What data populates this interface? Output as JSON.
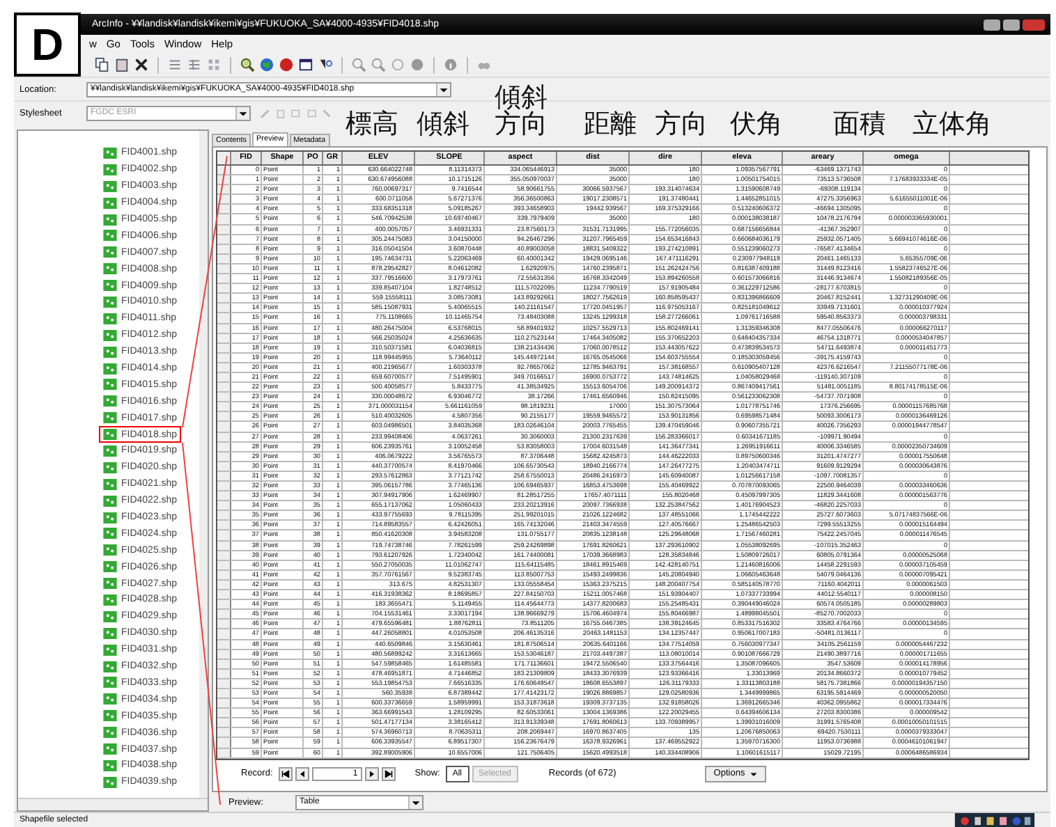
{
  "figure_label": "D",
  "window": {
    "title": "ArcInfo - ¥¥landisk¥landisk¥ikemi¥gis¥FUKUOKA_SA¥4000-4935¥FID4018.shp"
  },
  "menu": [
    "w",
    "Go",
    "Tools",
    "Window",
    "Help"
  ],
  "location": {
    "label": "Location:",
    "value": "¥¥landisk¥landisk¥ikemi¥gis¥FUKUOKA_SA¥4000-4935¥FID4018.shp"
  },
  "stylesheet": {
    "label": "Stylesheet",
    "value": "FGDC ESRI"
  },
  "tree": {
    "items": [
      {
        "label": "FID4001.shp",
        "highlighted": false
      },
      {
        "label": "FID4002.shp",
        "highlighted": false
      },
      {
        "label": "FID4003.shp",
        "highlighted": false
      },
      {
        "label": "FID4004.shp",
        "highlighted": false
      },
      {
        "label": "FID4005.shp",
        "highlighted": false
      },
      {
        "label": "FID4006.shp",
        "highlighted": false
      },
      {
        "label": "FID4007.shp",
        "highlighted": false
      },
      {
        "label": "FID4008.shp",
        "highlighted": false
      },
      {
        "label": "FID4009.shp",
        "highlighted": false
      },
      {
        "label": "FID4010.shp",
        "highlighted": false
      },
      {
        "label": "FID4011.shp",
        "highlighted": false
      },
      {
        "label": "FID4012.shp",
        "highlighted": false
      },
      {
        "label": "FID4013.shp",
        "highlighted": false
      },
      {
        "label": "FID4014.shp",
        "highlighted": false
      },
      {
        "label": "FID4015.shp",
        "highlighted": false
      },
      {
        "label": "FID4016.shp",
        "highlighted": false
      },
      {
        "label": "FID4017.shp",
        "highlighted": false
      },
      {
        "label": "FID4018.shp",
        "highlighted": true
      },
      {
        "label": "FID4019.shp",
        "highlighted": false
      },
      {
        "label": "FID4020.shp",
        "highlighted": false
      },
      {
        "label": "FID4021.shp",
        "highlighted": false
      },
      {
        "label": "FID4022.shp",
        "highlighted": false
      },
      {
        "label": "FID4023.shp",
        "highlighted": false
      },
      {
        "label": "FID4024.shp",
        "highlighted": false
      },
      {
        "label": "FID4025.shp",
        "highlighted": false
      },
      {
        "label": "FID4026.shp",
        "highlighted": false
      },
      {
        "label": "FID4027.shp",
        "highlighted": false
      },
      {
        "label": "FID4028.shp",
        "highlighted": false
      },
      {
        "label": "FID4029.shp",
        "highlighted": false
      },
      {
        "label": "FID4030.shp",
        "highlighted": false
      },
      {
        "label": "FID4031.shp",
        "highlighted": false
      },
      {
        "label": "FID4032.shp",
        "highlighted": false
      },
      {
        "label": "FID4033.shp",
        "highlighted": false
      },
      {
        "label": "FID4034.shp",
        "highlighted": false
      },
      {
        "label": "FID4035.shp",
        "highlighted": false
      },
      {
        "label": "FID4036.shp",
        "highlighted": false
      },
      {
        "label": "FID4037.shp",
        "highlighted": false
      },
      {
        "label": "FID4038.shp",
        "highlighted": false
      },
      {
        "label": "FID4039.shp",
        "highlighted": false
      }
    ]
  },
  "tabs": [
    {
      "label": "Contents",
      "selected": false
    },
    {
      "label": "Preview",
      "selected": true
    },
    {
      "label": "Metadata",
      "selected": false
    }
  ],
  "annotations": [
    "標高",
    "傾斜",
    "傾斜方向",
    "距離",
    "方向",
    "伏角",
    "面積",
    "立体角"
  ],
  "table": {
    "columns": [
      "FID",
      "Shape",
      "PO",
      "GR",
      "ELEV",
      "SLOPE",
      "aspect",
      "dist",
      "dire",
      "eleva",
      "areary",
      "omega"
    ],
    "rows": [
      [
        "0",
        "Point",
        "1",
        "1",
        "630.664022748",
        "8.11314373",
        "334.065446913",
        "35000",
        "180",
        "1.09357567791",
        "-63469.1371743",
        "0"
      ],
      [
        "1",
        "Point",
        "2",
        "1",
        "630.674956088",
        "10.1715126",
        "355.050970037",
        "35000",
        "180",
        "1.00501754015",
        "73513.5736508",
        "7.17683933334E-05"
      ],
      [
        "2",
        "Point",
        "3",
        "1",
        "760.00697317",
        "9.7416544",
        "58.90661755",
        "30066.5937567",
        "193.314074634",
        "1.31590608749",
        "-69308.119134",
        "0"
      ],
      [
        "3",
        "Point",
        "4",
        "1",
        "600.0711058",
        "5.67271376",
        "356.36500863",
        "19017.2308571",
        "191.37480441",
        "1.44652851015",
        "47275.3356963",
        "5.61655011001E-06"
      ],
      [
        "4",
        "Point",
        "5",
        "1",
        "333.68351318",
        "5.09185267",
        "393.34658903",
        "19442.939567",
        "169.375329166",
        "0.513240606372",
        "-46694.1305095",
        "0"
      ],
      [
        "5",
        "Point",
        "6",
        "1",
        "546.70942538",
        "10.69740467",
        "339.7979409",
        "35000",
        "180",
        "0.000138038187",
        "10478.2176794",
        "0.000003365930001"
      ],
      [
        "6",
        "Point",
        "7",
        "1",
        "400.0057057",
        "3.46931331",
        "23.87560173",
        "31531.7131995",
        "155.772056035",
        "0.687156656844",
        "-41367.352907",
        "0"
      ],
      [
        "7",
        "Point",
        "8",
        "1",
        "305.24475083",
        "3.04150000",
        "94.26467296",
        "31207.7965459",
        "154.653416843",
        "0.660684036179",
        "25932.0571405",
        "5.66941074616E-06"
      ],
      [
        "8",
        "Point",
        "9",
        "1",
        "316.05041504",
        "3.60870448",
        "40.89003058",
        "18831.5409322",
        "193.274210891",
        "0.551239060273",
        "-76587.4134654",
        "0"
      ],
      [
        "9",
        "Point",
        "10",
        "1",
        "195.74634731",
        "5.22063469",
        "60.40001342",
        "19429.0695146",
        "167.471116291",
        "0.230977948119",
        "20461.1465133",
        "5.65355709E-06"
      ],
      [
        "10",
        "Point",
        "11",
        "1",
        "878.29542827",
        "8.04612082",
        "1.62920975",
        "14760.2395871",
        "151.262424756",
        "0.816387409188",
        "31449.8123416",
        "1.55823746527E-06"
      ],
      [
        "11",
        "Point",
        "12",
        "1",
        "337.79516600",
        "3.17973761",
        "72.55631356",
        "16768.3342049",
        "153.894260558",
        "0.601573066816",
        "31446.9134674",
        "1.55082189356E-05"
      ],
      [
        "12",
        "Point",
        "13",
        "1",
        "339.85407104",
        "1.82748512",
        "111.57022095",
        "11234.7790519",
        "157.91905484",
        "0.361229712586",
        "-28177.6703815",
        "0"
      ],
      [
        "13",
        "Point",
        "14",
        "1",
        "559.15558111",
        "3.08573081",
        "143.89292661",
        "18027.7562619",
        "160.858595437",
        "0.831396866609",
        "20467.8152441",
        "1.32731290409E-06"
      ],
      [
        "14",
        "Point",
        "15",
        "1",
        "585.15087931",
        "5.40065515",
        "140.21161547",
        "17720.0451957",
        "116.975053167",
        "0.825181049612",
        "33949.7131601",
        "0.000010377924"
      ],
      [
        "15",
        "Point",
        "16",
        "1",
        "775.1108665",
        "10.11465754",
        "73.48403088",
        "13245.1299318",
        "158.277266061",
        "1.09761716588",
        "59540.8563373",
        "0.000003798331"
      ],
      [
        "16",
        "Point",
        "17",
        "1",
        "480.26475004",
        "6.53768015",
        "58.89401932",
        "10257.5529713",
        "155.802469141",
        "1.31359346308",
        "8477.05506476",
        "0.000066270117"
      ],
      [
        "17",
        "Point",
        "18",
        "1",
        "566.25035024",
        "4.25636635",
        "110.27523144",
        "17464.3405082",
        "155.370652203",
        "0.648404357334",
        "46754.1318771",
        "0.0000534047857"
      ],
      [
        "18",
        "Point",
        "19",
        "1",
        "310.50371581",
        "6.04036815",
        "138.21434436",
        "17060.0078512",
        "153.443057622",
        "0.473839534573",
        "54711.6493874",
        "0.000011451773"
      ],
      [
        "19",
        "Point",
        "20",
        "1",
        "118.99445955",
        "5.73640112",
        "145.44972144",
        "16765.0545066",
        "154.603755554",
        "0.185303059456",
        "-39175.4159743",
        "0"
      ],
      [
        "20",
        "Point",
        "21",
        "1",
        "400.21965677",
        "1.60303378",
        "92.78657062",
        "12785.9463791",
        "157.38168557",
        "0.610905407128",
        "42376.6216547",
        "7.21155077178E-06"
      ],
      [
        "21",
        "Point",
        "22",
        "1",
        "659.60700577",
        "7.51495901",
        "349.70166517",
        "16900.0753772",
        "143.74814625",
        "1.04058029468",
        "-119140.307109",
        "0"
      ],
      [
        "22",
        "Point",
        "23",
        "1",
        "500.40058577",
        "5.8433775",
        "41.38534925",
        "15513.6054706",
        "149.200914372",
        "0.867409417561",
        "51481.0051185",
        "8.80174178515E-06"
      ],
      [
        "23",
        "Point",
        "24",
        "1",
        "330.00048672",
        "6.93046772",
        "38.17266",
        "17461.6560946",
        "150.82415095",
        "0.561233062308",
        "-54737.7071908",
        "0"
      ],
      [
        "24",
        "Point",
        "25",
        "1",
        "371.000031154",
        "5.661161059",
        "98.1819231",
        "17000",
        "151.307573064",
        "1.01778751746",
        "17376.256695",
        "0.00001157685768"
      ],
      [
        "25",
        "Point",
        "26",
        "1",
        "510.40032605",
        "4.5807356",
        "90.2155177",
        "19559.9465572",
        "153.90131856",
        "0.69598571484",
        "50093.3006173",
        "0.0000136469126"
      ],
      [
        "26",
        "Point",
        "27",
        "1",
        "603.04986501",
        "3.84035368",
        "183.02646104",
        "20003.7765455",
        "139.470459046",
        "0.90607355721",
        "40026.7356293",
        "0.00001944778547"
      ],
      [
        "27",
        "Point",
        "28",
        "1",
        "233.99408406",
        "4.0637261",
        "30.3060003",
        "21300.2317639",
        "156.283366017",
        "0.60341671185",
        "-109971.90494",
        "0"
      ],
      [
        "28",
        "Point",
        "29",
        "1",
        "606.23935761",
        "3.10052458",
        "53.83058003",
        "17004.6031548",
        "141.36477341",
        "1.26951916611",
        "40006.3346585",
        "0.00002350734609"
      ],
      [
        "29",
        "Point",
        "30",
        "1",
        "406.0679222",
        "3.56765573",
        "87.3706448",
        "15682.4245873",
        "144.46222033",
        "0.89750600346",
        "31201.4747277",
        "0.000017550648"
      ],
      [
        "30",
        "Point",
        "31",
        "1",
        "440.37700574",
        "8.41970466",
        "106.65730543",
        "18940.2166774",
        "147.26477275",
        "1.20403474711",
        "91609.9129294",
        "0.000030643876"
      ],
      [
        "31",
        "Point",
        "32",
        "1",
        "293.57612863",
        "3.77121742",
        "258.67550013",
        "20486.2416973",
        "145.60940087",
        "1.01256617158",
        "-1097.70081357",
        "0"
      ],
      [
        "32",
        "Point",
        "33",
        "1",
        "395.06157786",
        "3.77465136",
        "106.69465937",
        "16853.4753698",
        "155.40469922",
        "0.707870093065",
        "22500.9464039",
        "0.000033460636"
      ],
      [
        "33",
        "Point",
        "34",
        "1",
        "307.94917906",
        "1.62469907",
        "81.28517255",
        "17657.4071111",
        "155.8020468",
        "0.45097997305",
        "11829.3441608",
        "0.000001563776"
      ],
      [
        "34",
        "Point",
        "35",
        "1",
        "655.17137062",
        "1.05060433",
        "233.20213916",
        "20097.7366938",
        "132.253847562",
        "1.40176904523",
        "-46820.2257033",
        "0"
      ],
      [
        "35",
        "Point",
        "36",
        "1",
        "433.97755693",
        "9.78115395",
        "251.99201015",
        "21026.1224682",
        "137.48551066",
        "1.1745442222",
        "25727.6073603",
        "5.07174837566E-06"
      ],
      [
        "36",
        "Point",
        "37",
        "1",
        "714.89583557",
        "6.42426051",
        "165.74132046",
        "21403.3474559",
        "127.40576667",
        "1.25486542503",
        "7299.55513255",
        "0.000015164494"
      ],
      [
        "37",
        "Point",
        "38",
        "1",
        "850.41620308",
        "3.94583208",
        "131.0755177",
        "20835.1238148",
        "125.29648068",
        "1.71567460281",
        "75422.2457045",
        "0.000011476545"
      ],
      [
        "38",
        "Point",
        "39",
        "1",
        "719.74738746",
        "7.78261599",
        "259.24269898",
        "17691.8260621",
        "137.293610902",
        "1.05538092695",
        "-107015.352463",
        "0"
      ],
      [
        "39",
        "Point",
        "40",
        "1",
        "793.61207926",
        "1.72340042",
        "161.74400081",
        "17039.3668983",
        "128.35834846",
        "1.50809726017",
        "60805.0791364",
        "0.00000525068"
      ],
      [
        "40",
        "Point",
        "41",
        "1",
        "550.27050035",
        "11.01062747",
        "115.64115485",
        "18461.8915469",
        "142.428140751",
        "1.21460816006",
        "14458.2291593",
        "0.000037105459"
      ],
      [
        "41",
        "Point",
        "42",
        "1",
        "357.70761567",
        "9.52383745",
        "113.85007753",
        "15493.2499836",
        "145.20804940",
        "1.06605463648",
        "54079.0464136",
        "0.000007095421"
      ],
      [
        "42",
        "Point",
        "43",
        "1",
        "313.675",
        "4.82531307",
        "133.05558454",
        "15363.2375215",
        "148.200407754",
        "0.585140578770",
        "71160.4042011",
        "0.0000061503"
      ],
      [
        "43",
        "Point",
        "44",
        "1",
        "416.31938362",
        "8.18695857",
        "227.84150703",
        "15211.0057468",
        "151.93904407",
        "1.07337733994",
        "44012.5540117",
        "0.000008150"
      ],
      [
        "44",
        "Point",
        "45",
        "1",
        "183.3655471",
        "5.1149455",
        "114.45644773",
        "14377.8200683",
        "155.25485431",
        "0.390449046024",
        "60574.0505185",
        "0.00000289803"
      ],
      [
        "45",
        "Point",
        "46",
        "1",
        "704.15531461",
        "3.33017194",
        "138.96669279",
        "15706.4604974",
        "155.80466987",
        "1.48998045501",
        "-85270.7002033",
        "0"
      ],
      [
        "46",
        "Point",
        "47",
        "1",
        "479.65596481",
        "1.88762811",
        "73.8511205",
        "16755.0467385",
        "138.39124645",
        "0.853317516302",
        "33583.4764766",
        "0.00000134595"
      ],
      [
        "47",
        "Point",
        "48",
        "1",
        "447.26058801",
        "4.01053508",
        "206.46135316",
        "20463.1481153",
        "134.12357447",
        "0.950617007183",
        "-50481.0136117",
        "0"
      ],
      [
        "48",
        "Point",
        "49",
        "1",
        "440.6509846",
        "3.15630461",
        "181.87506514",
        "20635.6401166",
        "134.77514059",
        "0.756030977347",
        "34105.2561159",
        "0.0000054467232"
      ],
      [
        "49",
        "Point",
        "50",
        "1",
        "480.56899242",
        "3.31613665",
        "153.53046187",
        "21703.4497387",
        "113.08010014",
        "0.901087666729",
        "21490.3897716",
        "0.000001711655"
      ],
      [
        "50",
        "Point",
        "51",
        "1",
        "547.59858465",
        "1.61485581",
        "171.71136601",
        "19472.5506540",
        "133.37564416",
        "1.35087096605",
        "3547.53609",
        "0.000014178956"
      ],
      [
        "51",
        "Point",
        "52",
        "1",
        "478.46951871",
        "4.71446852",
        "183.21309809",
        "18433.3076939",
        "123.93366416",
        "1.33013969",
        "20134.8660372",
        "0.000010779452"
      ],
      [
        "52",
        "Point",
        "53",
        "1",
        "553.19854753",
        "7.66516335",
        "176.60649547",
        "18608.6553897",
        "126.31179333",
        "1.33113803188",
        "58175.7381866",
        "0.00000194357150"
      ],
      [
        "53",
        "Point",
        "54",
        "1",
        "560.35938",
        "6.87389442",
        "177.41423172",
        "19026.8869857",
        "129.02580936",
        "1.3449999865",
        "63195.5914469",
        "0.000000520050"
      ],
      [
        "54",
        "Point",
        "55",
        "1",
        "600.33736659",
        "1.58959991",
        "153.31873618",
        "19309.3737135",
        "132.91858026",
        "1.36912665346",
        "40362.0955862",
        "0.000017334476"
      ],
      [
        "55",
        "Point",
        "56",
        "1",
        "363.66991543",
        "1.28109295",
        "82.60533061",
        "13004.1369386",
        "122.20029455",
        "0.64394606134",
        "27203.8300386",
        "0.000009542"
      ],
      [
        "56",
        "Point",
        "57",
        "1",
        "501.47177134",
        "3.38165412",
        "313.91339348",
        "17691.8060613",
        "133.709389957",
        "1.39931016009",
        "31991.5765408",
        "0.00010050101515"
      ],
      [
        "57",
        "Point",
        "58",
        "1",
        "574.36960713",
        "8.70635311",
        "208.2069447",
        "16970.8637405",
        "135",
        "1.20676850063",
        "69420.7530111",
        "0.0000379333047"
      ],
      [
        "58",
        "Point",
        "59",
        "1",
        "606.33935547",
        "6.89517307",
        "156.23676479",
        "16378.9326961",
        "137.469552922",
        "1.35970716300",
        "11953.0736988",
        "0.00046101061947"
      ],
      [
        "59",
        "Point",
        "60",
        "1",
        "392.89005906",
        "10.6557006",
        "121.7506405",
        "15620.4993518",
        "140.334408906",
        "1.10601615117",
        "15029.72195",
        "0.0006486586934"
      ]
    ]
  },
  "navigator": {
    "label": "Record:",
    "current": "1",
    "show_label": "Show:",
    "show_options": [
      {
        "label": "All",
        "selected": true
      },
      {
        "label": "Selected",
        "selected": false
      }
    ],
    "count": "Records (of 672)",
    "options": "Options"
  },
  "preview": {
    "label": "Preview:",
    "value": "Table"
  },
  "status_bar": "Shapefile selected"
}
